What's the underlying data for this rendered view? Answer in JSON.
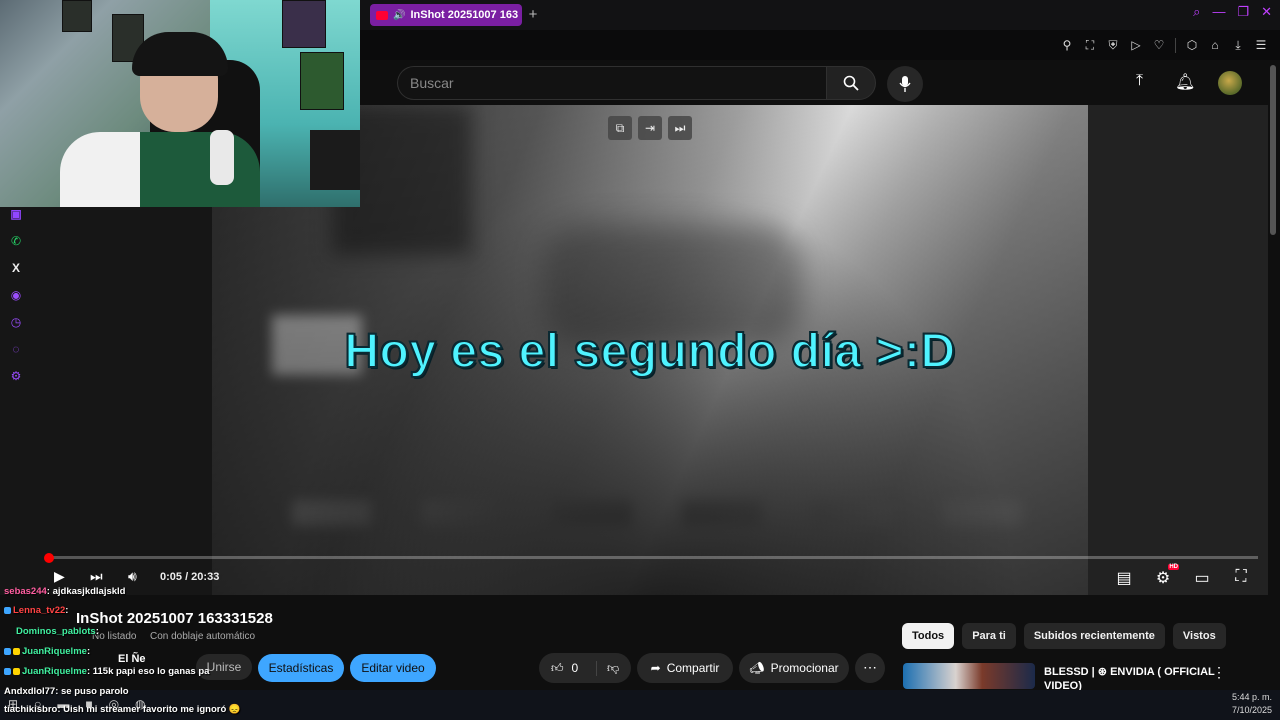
{
  "browser": {
    "tab_title": "InShot 20251007 163",
    "new_tab": "+"
  },
  "header": {
    "search_placeholder": "Buscar"
  },
  "player": {
    "caption": "Hoy es el segundo día >:D",
    "time": "0:05 / 20:33",
    "progress_fraction": 0.004
  },
  "video": {
    "title": "InShot 20251007 163331528",
    "subtitle1": "No listado",
    "subtitle2": "Con doblaje automático",
    "buttons": {
      "join": "Unirse",
      "stats": "Estadísticas",
      "edit": "Editar video",
      "likes": "0",
      "share": "Compartir",
      "promote": "Promocionar"
    }
  },
  "chips": [
    "Todos",
    "Para ti",
    "Subidos recientemente",
    "Vistos"
  ],
  "recommendation": {
    "title": "BLESSD | ⊛ ENVIDIA ( OFFICIAL",
    "title2": "VIDEO)"
  },
  "chat": [
    {
      "user": "sebas244",
      "msg": ": ajdkasjkdlajskld"
    },
    {
      "user": "Lenna_tv22",
      "msg": ":"
    },
    {
      "user": "Dominos_pablots",
      "msg": ":"
    },
    {
      "user": "JuanRiquelme",
      "msg": ":"
    },
    {
      "user": "JuanRiquelme",
      "msg": ": 115k papi eso lo ganas pa"
    },
    {
      "user": "Andxdlol77",
      "msg": ": se puso parolo"
    },
    {
      "user": "tiachikisbro",
      "msg": ": Uish mi streamer favorito me ignoró 😞"
    }
  ],
  "overlay_name": "El Ñe",
  "clock": {
    "time": "5:44 p. m.",
    "date": "7/10/2025"
  },
  "colors": {
    "accent_blue": "#3ea6ff",
    "caption_cyan": "#4ff3ff",
    "progress_red": "#ff0000",
    "tab_purple": "#7a1fa2"
  }
}
